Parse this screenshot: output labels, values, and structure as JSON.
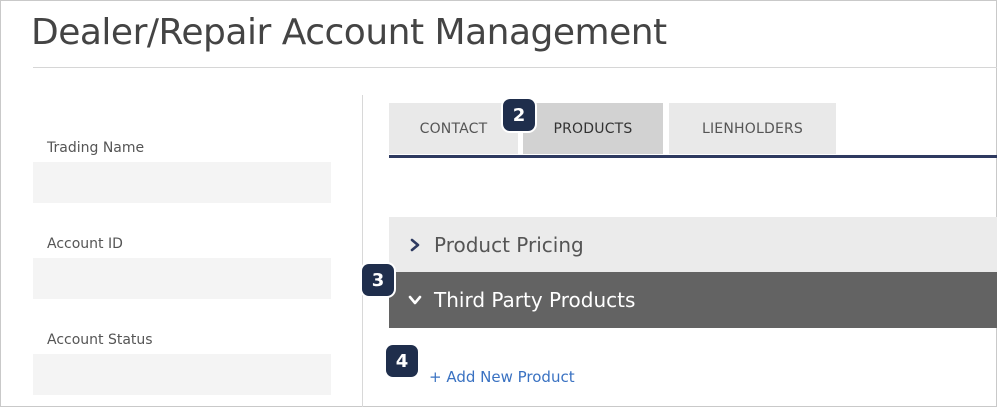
{
  "page": {
    "title": "Dealer/Repair Account Management"
  },
  "left_panel": {
    "fields": [
      {
        "label": "Trading Name",
        "value": ""
      },
      {
        "label": "Account ID",
        "value": ""
      },
      {
        "label": "Account Status",
        "value": ""
      }
    ]
  },
  "tabs": [
    {
      "label": "CONTACT",
      "active": false
    },
    {
      "label": "PRODUCTS",
      "active": true
    },
    {
      "label": "LIENHOLDERS",
      "active": false
    }
  ],
  "accordions": [
    {
      "title": "Product Pricing",
      "expanded": false,
      "icon": "chevron-right-icon"
    },
    {
      "title": "Third Party Products",
      "expanded": true,
      "icon": "chevron-down-icon"
    }
  ],
  "actions": {
    "add_new_product": "+ Add New Product"
  },
  "callouts": [
    "2",
    "3",
    "4"
  ],
  "colors": {
    "accent_navy": "#2e3a60",
    "badge": "#1f2e4c",
    "link": "#3a72c2",
    "open_section": "#636363"
  }
}
